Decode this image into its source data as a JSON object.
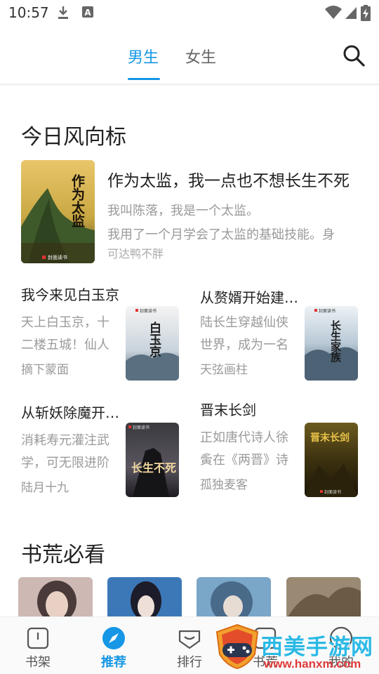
{
  "status_bar": {
    "time": "10:57",
    "icons": [
      "download-icon",
      "text-a-icon",
      "wifi-icon",
      "signal-icon",
      "battery-charging-icon"
    ]
  },
  "header": {
    "tabs": [
      {
        "label": "男生",
        "active": true
      },
      {
        "label": "女生",
        "active": false
      }
    ],
    "search_icon": "search-icon",
    "accent_color": "#1597e5"
  },
  "section_trend": {
    "title": "今日风向标",
    "featured": {
      "cover_title": "作为太监",
      "cover_badge": "封面读书",
      "title": "作为太监，我一点也不想长生不死",
      "desc_lines": [
        "我叫陈落，我是一个太监。",
        "我用了一个月学会了太监的基础技能。身"
      ],
      "author": "可达鸭不胖"
    },
    "books": [
      {
        "title": "我今来见白玉京",
        "desc_lines": [
          "天上白玉京，十",
          "二楼五城！仙人"
        ],
        "author": "摘下蒙面",
        "cover_title": "白玉京",
        "cover_badge": "封面读书"
      },
      {
        "title": "从赘婿开始建立长生家族",
        "desc_lines": [
          "陆长生穿越仙侠",
          "世界，成为一名"
        ],
        "author": "天弦画柱",
        "cover_title": "长生家族",
        "cover_badge": "封面读书"
      },
      {
        "title": "从斩妖除魔开始长生不死",
        "desc_lines": [
          "消耗寿元灌注武",
          "学，可无限进阶"
        ],
        "author": "陆月十九",
        "cover_title": "长生不死",
        "cover_badge": "封面读书"
      },
      {
        "title": "晋末长剑",
        "desc_lines": [
          "正如唐代诗人徐",
          "夤在《两晋》诗"
        ],
        "author": "孤独麦客",
        "cover_title": "晋末长剑",
        "cover_badge": "封面读书"
      }
    ]
  },
  "section_must_read": {
    "title": "书荒必看"
  },
  "bottom_nav": [
    {
      "label": "书架",
      "icon": "bookshelf-icon",
      "active": false
    },
    {
      "label": "推荐",
      "icon": "compass-icon",
      "active": true
    },
    {
      "label": "排行",
      "icon": "ranking-icon",
      "active": false
    },
    {
      "label": "书荒",
      "icon": "book-shortage-icon",
      "active": false
    },
    {
      "label": "我的",
      "icon": "profile-icon",
      "active": false
    }
  ],
  "watermark": {
    "text": "西美手游网",
    "url": "www.hanxm.com",
    "logo_icon": "gamepad-shield-icon"
  }
}
